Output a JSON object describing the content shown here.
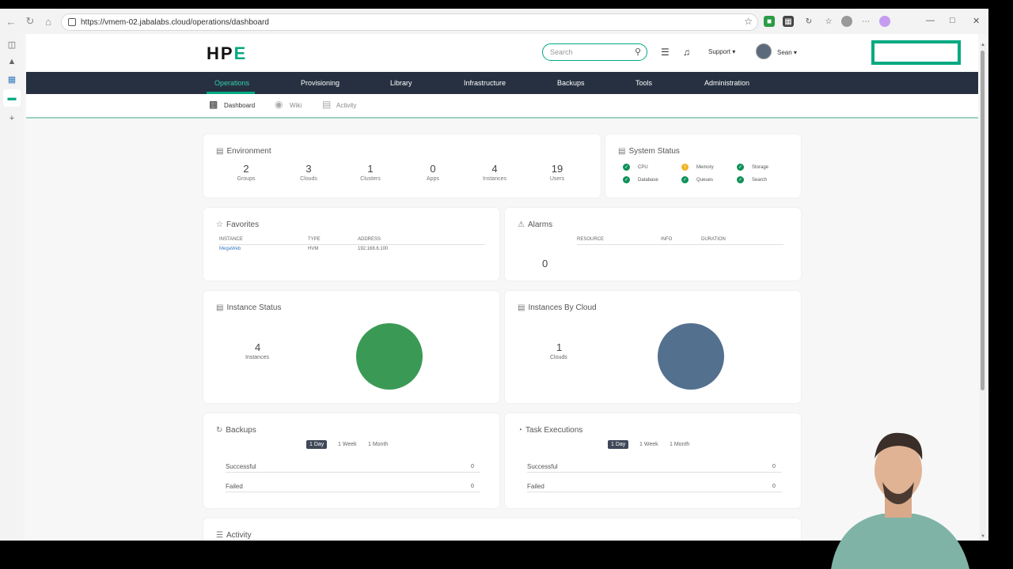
{
  "browser": {
    "url": "https://vmem-02.jabalabs.cloud/operations/dashboard"
  },
  "header": {
    "logo_main": "HP",
    "logo_accent": "E",
    "search_placeholder": "Search",
    "support_label": "Support ▾",
    "user_label": "Sean ▾"
  },
  "mainnav": {
    "items": [
      "Operations",
      "Provisioning",
      "Library",
      "Infrastructure",
      "Backups",
      "Tools",
      "Administration"
    ]
  },
  "subnav": {
    "items": [
      "Dashboard",
      "Wiki",
      "Activity"
    ]
  },
  "environment": {
    "title": "Environment",
    "stats": [
      {
        "value": "2",
        "label": "Groups"
      },
      {
        "value": "3",
        "label": "Clouds"
      },
      {
        "value": "1",
        "label": "Clusters"
      },
      {
        "value": "0",
        "label": "Apps"
      },
      {
        "value": "4",
        "label": "Instances"
      },
      {
        "value": "19",
        "label": "Users"
      }
    ]
  },
  "system_status": {
    "title": "System Status",
    "items": [
      {
        "label": "CPU",
        "status": "ok"
      },
      {
        "label": "Memory",
        "status": "warn"
      },
      {
        "label": "Storage",
        "status": "ok"
      },
      {
        "label": "Database",
        "status": "ok"
      },
      {
        "label": "Queues",
        "status": "ok"
      },
      {
        "label": "Search",
        "status": "ok"
      }
    ],
    "ok_color": "#0e9159",
    "warn_color": "#f0b429"
  },
  "favorites": {
    "title": "Favorites",
    "columns": [
      "INSTANCE",
      "TYPE",
      "ADDRESS"
    ],
    "rows": [
      [
        "MegaWeb",
        "HVM",
        "192.168.6.100"
      ]
    ]
  },
  "alarms": {
    "title": "Alarms",
    "columns": [
      "RESOURCE",
      "INFO",
      "DURATION"
    ],
    "count": "0"
  },
  "instance_status": {
    "title": "Instance Status",
    "value": "4",
    "label": "Instances",
    "color": "#3a9a55"
  },
  "instances_by_cloud": {
    "title": "Instances By Cloud",
    "value": "1",
    "label": "Clouds",
    "color": "#53708f"
  },
  "backups": {
    "title": "Backups",
    "ranges": [
      "1 Day",
      "1 Week",
      "1 Month"
    ],
    "rows": [
      {
        "label": "Successful",
        "value": "0"
      },
      {
        "label": "Failed",
        "value": "0"
      }
    ]
  },
  "task_executions": {
    "title": "Task Executions",
    "ranges": [
      "1 Day",
      "1 Week",
      "1 Month"
    ],
    "rows": [
      {
        "label": "Successful",
        "value": "0"
      },
      {
        "label": "Failed",
        "value": "0"
      }
    ]
  },
  "activity": {
    "title": "Activity"
  },
  "accent_color": "#01a982"
}
